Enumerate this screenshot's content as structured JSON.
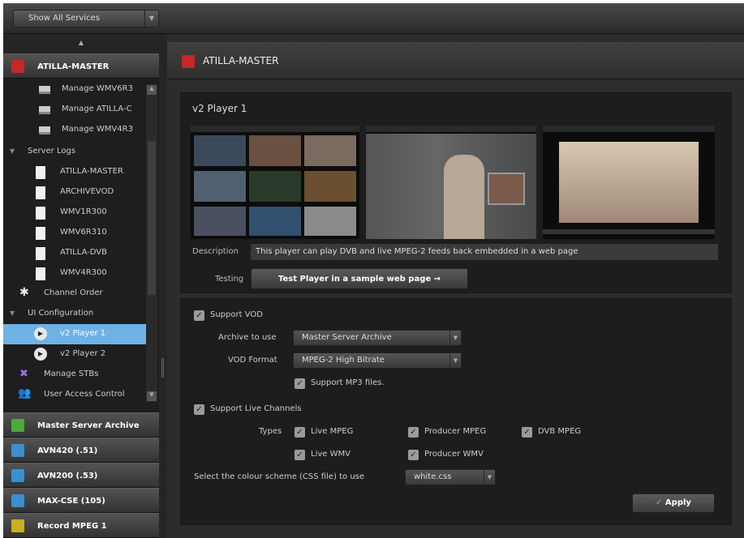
{
  "topbar": {
    "show_all_label": "Show All Services"
  },
  "sidebar": {
    "services": [
      {
        "name": "ATILLA-MASTER",
        "color": "#c42828"
      },
      {
        "name": "Master Server Archive",
        "color": "#4caa3c"
      },
      {
        "name": "AVN420 (.51)",
        "color": "#3a8fd0"
      },
      {
        "name": "AVN200 (.53)",
        "color": "#3a8fd0"
      },
      {
        "name": "MAX-CSE (105)",
        "color": "#3a8fd0"
      },
      {
        "name": "Record MPEG 1",
        "color": "#c8b020"
      }
    ],
    "items": {
      "manage1": "Manage WMV6R3",
      "manage2": "Manage ATILLA-C",
      "manage3": "Manage WMV4R3",
      "server_logs": "Server Logs",
      "log1": "ATILLA-MASTER",
      "log2": "ARCHIVEVOD",
      "log3": "WMV1R300",
      "log4": "WMV6R310",
      "log5": "ATILLA-DVB",
      "log6": "WMV4R300",
      "channel_order": "Channel Order",
      "ui_config": "UI Configuration",
      "player1": "v2 Player 1",
      "player2": "v2 Player 2",
      "manage_stbs": "Manage STBs",
      "user_access": "User Access Control"
    }
  },
  "main": {
    "header_title": "ATILLA-MASTER",
    "player_title": "v2 Player 1",
    "description_label": "Description",
    "description_value": "This player can play DVB and live MPEG-2 feeds back embedded in a web page",
    "testing_label": "Testing",
    "test_button": "Test Player in a sample web page →",
    "support_vod": "Support VOD",
    "archive_label": "Archive to use",
    "archive_value": "Master Server Archive",
    "vod_format_label": "VOD Format",
    "vod_format_value": "MPEG-2 High Bitrate",
    "support_mp3": "Support MP3 files.",
    "support_live": "Support Live Channels",
    "types_label": "Types",
    "type_live_mpeg": "Live MPEG",
    "type_producer_mpeg": "Producer MPEG",
    "type_dvb_mpeg": "DVB MPEG",
    "type_live_wmv": "Live WMV",
    "type_producer_wmv": "Producer WMV",
    "colour_scheme_label": "Select the colour scheme (CSS file) to use",
    "colour_scheme_value": "white.css",
    "apply_button": "Apply"
  }
}
